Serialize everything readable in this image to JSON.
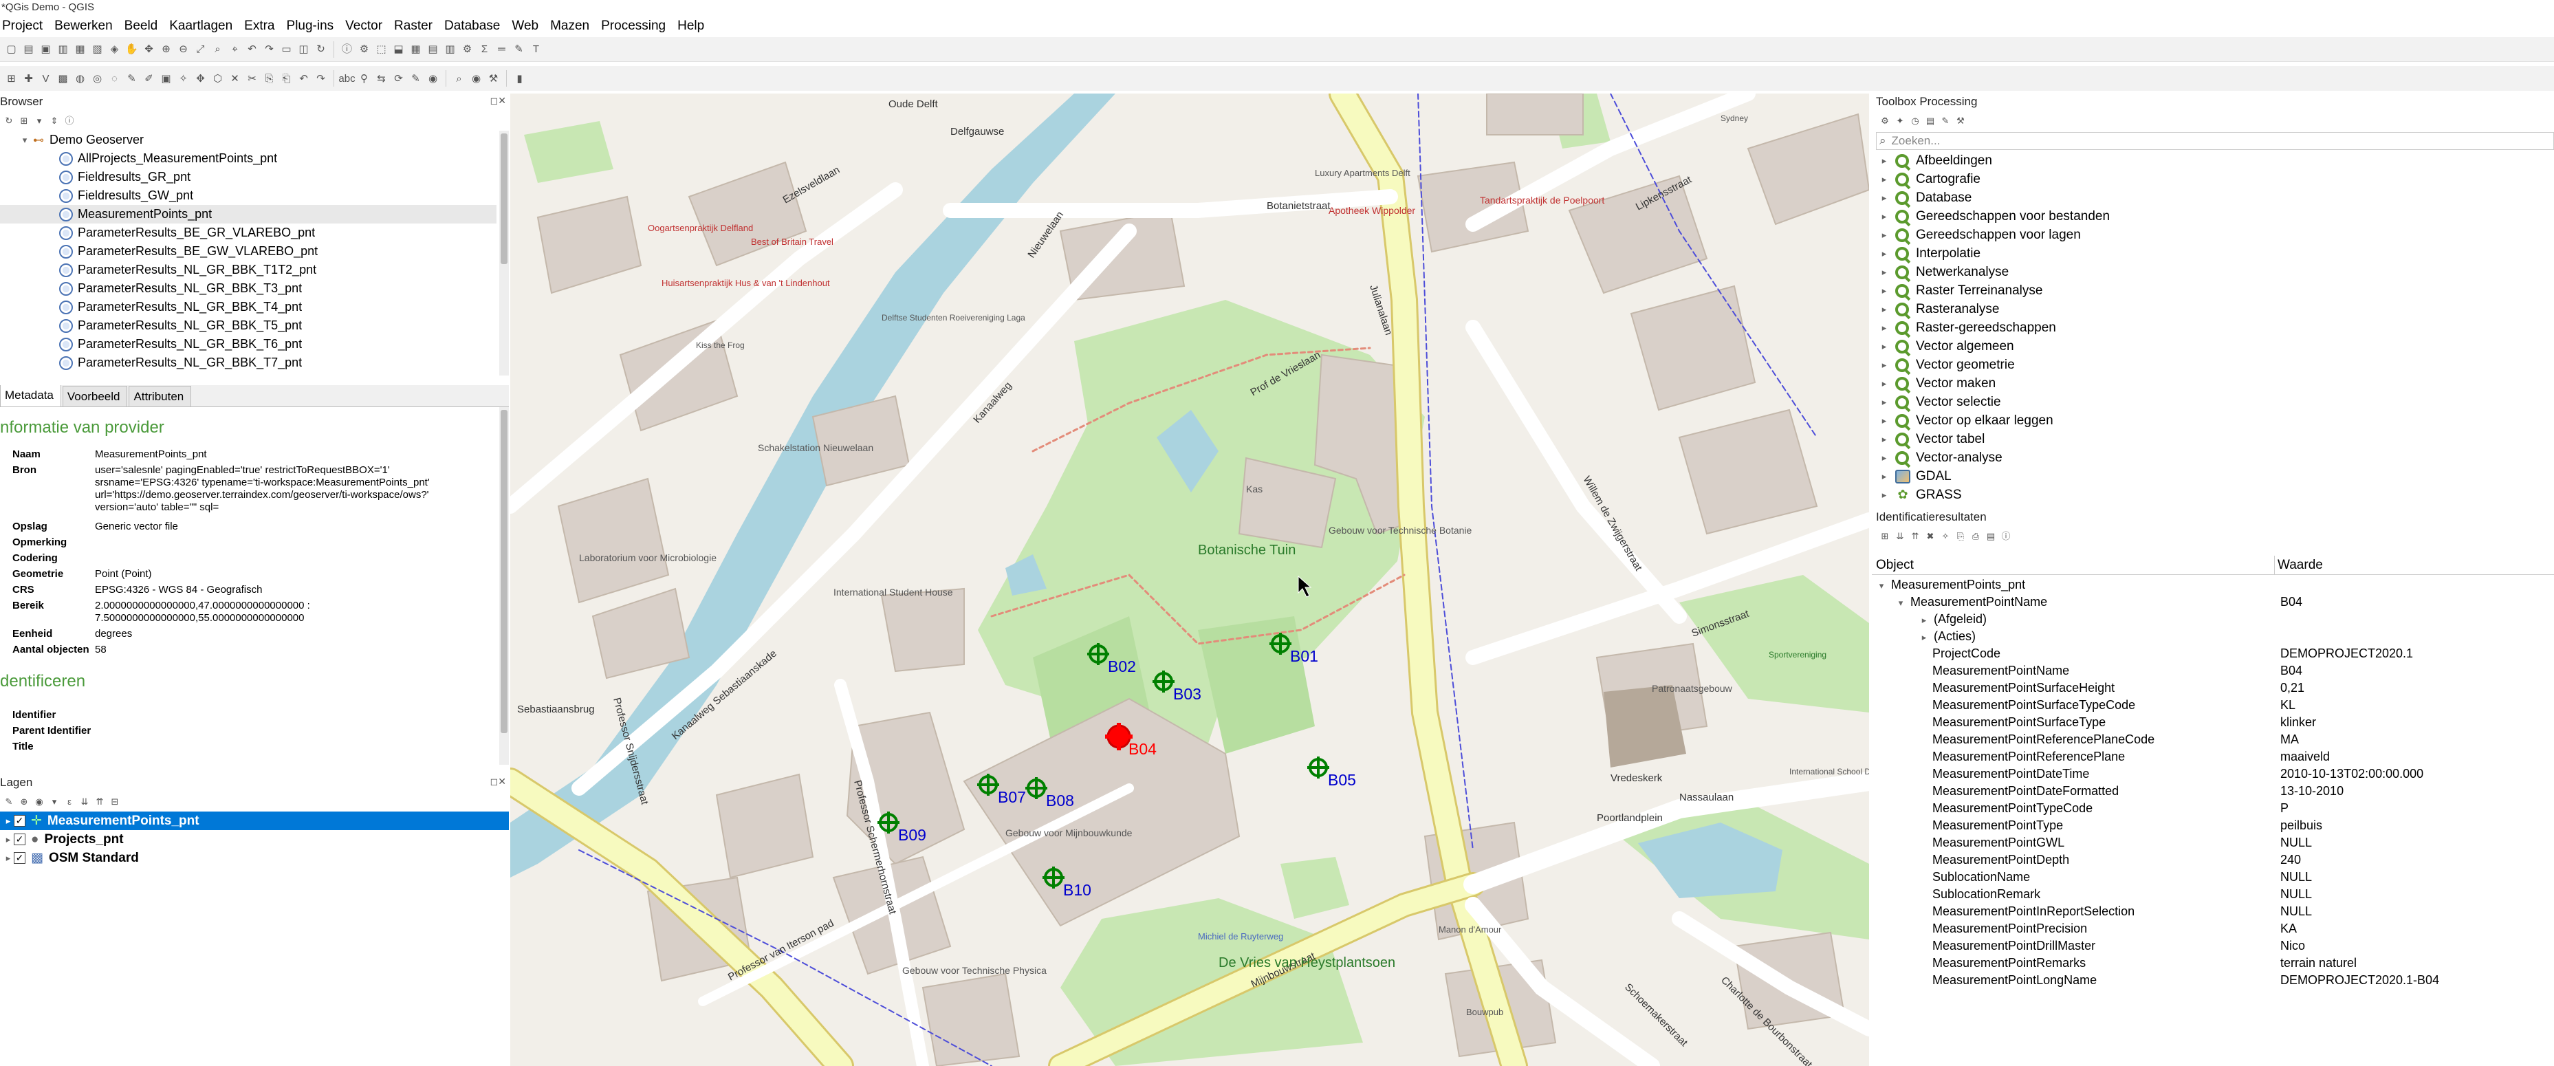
{
  "window": {
    "title": "*QGis Demo - QGIS"
  },
  "menu": [
    "Project",
    "Bewerken",
    "Beeld",
    "Kaartlagen",
    "Extra",
    "Plug-ins",
    "Vector",
    "Raster",
    "Database",
    "Web",
    "Mazen",
    "Processing",
    "Help"
  ],
  "browser": {
    "title": "Browser",
    "root": "Demo Geoserver",
    "items": [
      "AllProjects_MeasurementPoints_pnt",
      "Fieldresults_GR_pnt",
      "Fieldresults_GW_pnt",
      "MeasurementPoints_pnt",
      "ParameterResults_BE_GR_VLAREBO_pnt",
      "ParameterResults_BE_GW_VLAREBO_pnt",
      "ParameterResults_NL_GR_BBK_T1T2_pnt",
      "ParameterResults_NL_GR_BBK_T3_pnt",
      "ParameterResults_NL_GR_BBK_T4_pnt",
      "ParameterResults_NL_GR_BBK_T5_pnt",
      "ParameterResults_NL_GR_BBK_T6_pnt",
      "ParameterResults_NL_GR_BBK_T7_pnt"
    ]
  },
  "meta_tabs": [
    "Metadata",
    "Voorbeeld",
    "Attributen"
  ],
  "metadata": {
    "provider_heading": "nformatie van provider",
    "rows": [
      {
        "k": "Naam",
        "v": "MeasurementPoints_pnt"
      },
      {
        "k": "Bron",
        "v": "user='salesnle' pagingEnabled='true' restrictToRequestBBOX='1'\nsrsname='EPSG:4326' typename='ti-workspace:MeasurementPoints_pnt'\nurl='https://demo.geoserver.terraindex.com/geoserver/ti-workspace/ows?'\nversion='auto' table=\"\" sql="
      },
      {
        "k": "Opslag",
        "v": "Generic vector file"
      },
      {
        "k": "Opmerking",
        "v": ""
      },
      {
        "k": "Codering",
        "v": ""
      },
      {
        "k": "Geometrie",
        "v": "Point (Point)"
      },
      {
        "k": "CRS",
        "v": "EPSG:4326 - WGS 84 - Geografisch"
      },
      {
        "k": "Bereik",
        "v": "2.0000000000000000,47.0000000000000000 :\n7.5000000000000000,55.0000000000000000"
      },
      {
        "k": "Eenheid",
        "v": "degrees"
      },
      {
        "k": "Aantal objecten",
        "v": "58"
      }
    ],
    "identify_heading": "dentificeren",
    "identify_rows": [
      {
        "k": "Identifier",
        "v": ""
      },
      {
        "k": "Parent Identifier",
        "v": ""
      },
      {
        "k": "Title",
        "v": ""
      }
    ]
  },
  "layers": {
    "title": "Lagen",
    "items": [
      {
        "name": "MeasurementPoints_pnt",
        "checked": true,
        "selected": true
      },
      {
        "name": "Projects_pnt",
        "checked": true,
        "selected": false
      },
      {
        "name": "OSM Standard",
        "checked": true,
        "selected": false
      }
    ]
  },
  "toolbox": {
    "title": "Toolbox Processing",
    "search_placeholder": "Zoeken...",
    "items": [
      "Afbeeldingen",
      "Cartografie",
      "Database",
      "Gereedschappen voor bestanden",
      "Gereedschappen voor lagen",
      "Interpolatie",
      "Netwerkanalyse",
      "Raster Terreinanalyse",
      "Rasteranalyse",
      "Raster-gereedschappen",
      "Vector algemeen",
      "Vector geometrie",
      "Vector maken",
      "Vector selectie",
      "Vector op elkaar leggen",
      "Vector tabel",
      "Vector-analyse"
    ],
    "providers": [
      "GDAL",
      "GRASS"
    ]
  },
  "identify": {
    "title": "Identificatieresultaten",
    "col_object": "Object",
    "col_value": "Waarde",
    "layer": "MeasurementPoints_pnt",
    "feature_field": "MeasurementPointName",
    "feature_value": "B04",
    "derived": "(Afgeleid)",
    "actions": "(Acties)",
    "attributes": [
      {
        "k": "ProjectCode",
        "v": "DEMOPROJECT2020.1"
      },
      {
        "k": "MeasurementPointName",
        "v": "B04"
      },
      {
        "k": "MeasurementPointSurfaceHeight",
        "v": "0,21"
      },
      {
        "k": "MeasurementPointSurfaceTypeCode",
        "v": "KL"
      },
      {
        "k": "MeasurementPointSurfaceType",
        "v": "klinker"
      },
      {
        "k": "MeasurementPointReferencePlaneCode",
        "v": "MA"
      },
      {
        "k": "MeasurementPointReferencePlane",
        "v": "maaiveld"
      },
      {
        "k": "MeasurementPointDateTime",
        "v": "2010-10-13T02:00:00.000"
      },
      {
        "k": "MeasurementPointDateFormatted",
        "v": "13-10-2010"
      },
      {
        "k": "MeasurementPointTypeCode",
        "v": "P"
      },
      {
        "k": "MeasurementPointType",
        "v": "peilbuis"
      },
      {
        "k": "MeasurementPointGWL",
        "v": "NULL"
      },
      {
        "k": "MeasurementPointDepth",
        "v": "240"
      },
      {
        "k": "SublocationName",
        "v": "NULL"
      },
      {
        "k": "SublocationRemark",
        "v": "NULL"
      },
      {
        "k": "MeasurementPointInReportSelection",
        "v": "NULL"
      },
      {
        "k": "MeasurementPointPrecision",
        "v": "KA"
      },
      {
        "k": "MeasurementPointDrillMaster",
        "v": "Nico"
      },
      {
        "k": "MeasurementPointRemarks",
        "v": "terrain naturel"
      },
      {
        "k": "MeasurementPointLongName",
        "v": "DEMOPROJECT2020.1-B04"
      }
    ]
  },
  "map": {
    "points": [
      "B01",
      "B02",
      "B03",
      "B04",
      "B05",
      "B07",
      "B08",
      "B09",
      "B10"
    ],
    "selected_point": "B04",
    "streets": [
      "Botanietstraat",
      "Julianalaan",
      "Kanaalweg",
      "Nieuwelaan",
      "Prof de Vrieslaan",
      "Mijnbouwstraat",
      "Poortlandplein",
      "Nassaulaan",
      "Simonsstraat",
      "Schoemakerstraat",
      "Professor Schermerhornstraat",
      "Professor van Iterson pad",
      "Professor Snijdersstraat",
      "Sebastiaansbrug",
      "Lipkensstraat",
      "Ezelsveldlaan",
      "Delfgauwse",
      "Willem de Zwijgerstraat",
      "Oude Delft",
      "Charlotte de Bourbonstraat",
      "Kanaalweg Sebastiaanskade",
      "Vredeskerk"
    ],
    "places": [
      "Botanische Tuin",
      "Kas",
      "Gebouw voor Technische Botanie",
      "International Student House",
      "Schakelstation Nieuwelaan",
      "Laboratorium voor Microbiologie",
      "Gebouw voor Mijnbouwkunde",
      "De Vries van Heystplantsoen",
      "Gebouw voor Technische Physica",
      "Patronaatsgebouw",
      "Apotheek Wippolder",
      "Tandartspraktijk de Poelpoort",
      "Delftse Studenten Roeivereniging Laga",
      "Huisartsenpraktijk Hus & van 't Lindenhout",
      "Oogartsenpraktijk Delfland",
      "Best of Britain Travel",
      "Luxury Apartments Delft",
      "Michiel de Ruyterweg",
      "Bouwpub",
      "Manon d'Amour",
      "Kiss the Frog",
      "Sportvereniging",
      "International School Delft",
      "Sydney"
    ]
  },
  "colors": {
    "accent": "#0078d7",
    "qgis_green": "#5b9a2d",
    "selected_red": "#ff0000",
    "point_green": "#008000",
    "map_label_blue": "#0000cc"
  }
}
